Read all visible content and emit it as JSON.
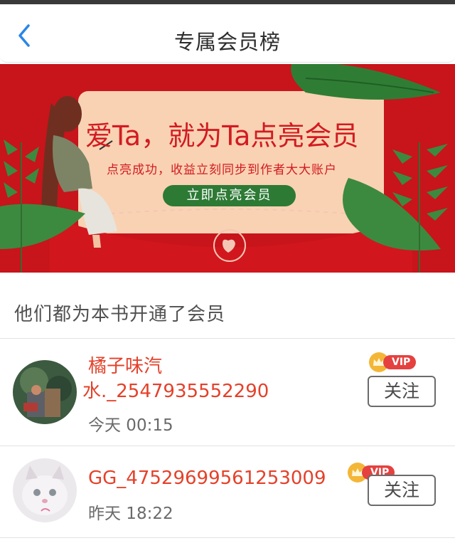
{
  "header": {
    "title": "专属会员榜",
    "back_icon": "chevron-left-icon"
  },
  "banner": {
    "headline": "爱Ta，就为Ta点亮会员",
    "subtitle": "点亮成功，收益立刻同步到作者大大账户",
    "cta_label": "立即点亮会员",
    "colors": {
      "background": "#c8141b",
      "card": "#f9d2b3",
      "cta": "#2d7a35"
    }
  },
  "members_section": {
    "title": "他们都为本书开通了会员"
  },
  "members": [
    {
      "name_line1": "橘子味汽",
      "name_line2": "水._2547935552290",
      "time": "今天 00:15",
      "badge": "VIP",
      "follow_label": "关注"
    },
    {
      "name_line1": "GG_47529699561253009",
      "time": "昨天 18:22",
      "badge": "VIP",
      "follow_label": "关注"
    }
  ],
  "colors": {
    "name": "#e4412a",
    "vip_badge": "#e4413f",
    "crown": "#f3b637"
  }
}
